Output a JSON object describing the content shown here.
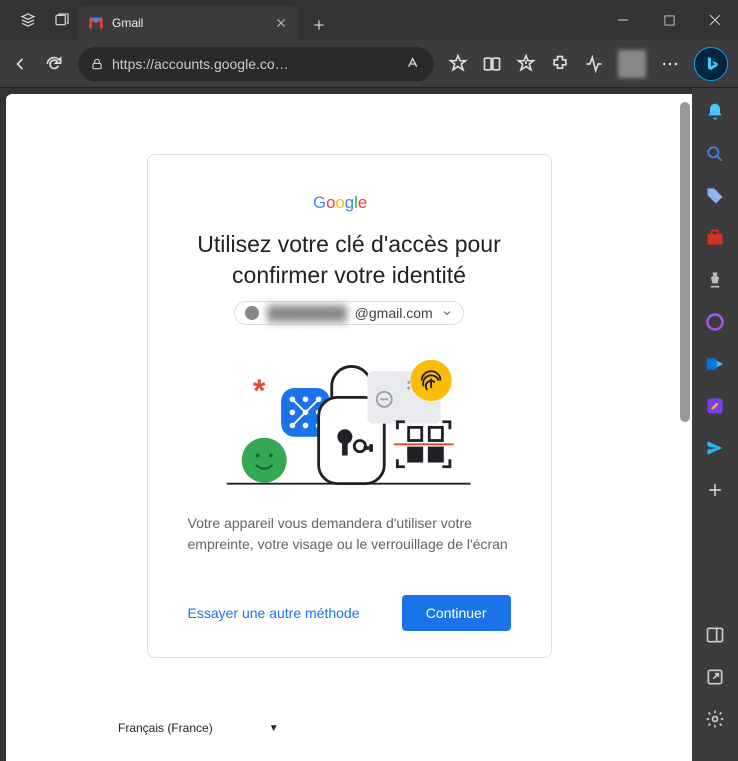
{
  "window": {
    "tab_title": "Gmail"
  },
  "toolbar": {
    "url": "https://accounts.google.co…"
  },
  "card": {
    "heading": "Utilisez votre clé d'accès pour confirmer votre identité",
    "email_obscured": "████████",
    "email_suffix": "@gmail.com",
    "description": "Votre appareil vous demandera d'utiliser votre empreinte, votre visage ou le verrouillage de l'écran",
    "try_another": "Essayer une autre méthode",
    "continue": "Continuer"
  },
  "footer": {
    "language": "Français (France)"
  },
  "sidebar_icons": [
    "bell",
    "search",
    "tag",
    "briefcase",
    "chess",
    "office",
    "outlook",
    "edit",
    "send",
    "plus"
  ]
}
